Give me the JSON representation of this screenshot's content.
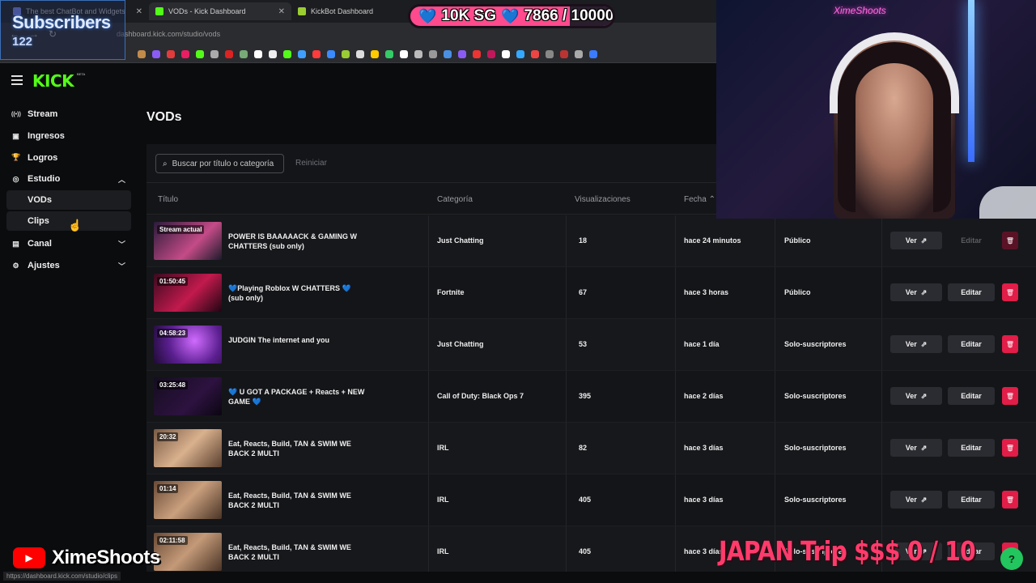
{
  "browser": {
    "tabs": [
      {
        "label": "The best ChatBot and Widgets",
        "fav_color": "#7c8cff",
        "active": false
      },
      {
        "label": "VODs - Kick Dashboard",
        "fav_color": "#53fc18",
        "active": true
      },
      {
        "label": "KickBot Dashboard",
        "fav_color": "#9acd32",
        "active": false
      }
    ],
    "url": "dashboard.kick.com/studio/vods",
    "status_url": "https://dashboard.kick.com/studio/clips"
  },
  "overlays": {
    "subs_title": "Subscribers",
    "subs_count": "122",
    "goal_text": "10K SG",
    "goal_count": "7866 / 10000",
    "goal_progress": 0.7866,
    "youtube_handle": "XimeShoots",
    "japan_goal": "JAPAN Trip $$$ 0 / 10",
    "cam_sign": "XimeShoots"
  },
  "app": {
    "logo": "KICK",
    "beta": "BETA",
    "page_title": "VODs",
    "search_placeholder": "Buscar por título o categoría",
    "reset_label": "Reiniciar"
  },
  "sidebar": {
    "items": [
      {
        "label": "Stream",
        "icon": "broadcast-icon"
      },
      {
        "label": "Ingresos",
        "icon": "money-icon"
      },
      {
        "label": "Logros",
        "icon": "trophy-icon"
      },
      {
        "label": "Estudio",
        "icon": "studio-icon",
        "expanded": true
      }
    ],
    "sub_items": [
      "VODs",
      "Clips"
    ],
    "items_after": [
      {
        "label": "Canal",
        "icon": "channel-icon"
      },
      {
        "label": "Ajustes",
        "icon": "gear-icon"
      }
    ]
  },
  "table": {
    "headers": {
      "title": "Título",
      "category": "Categoría",
      "views": "Visualizaciones",
      "date": "Fecha"
    },
    "view_label": "Ver",
    "edit_label": "Editar",
    "rows": [
      {
        "badge": "Stream actual",
        "title": "POWER IS BAAAAACK & GAMING W CHATTERS (sub only)",
        "category": "Just Chatting",
        "views": "18",
        "date": "hace 24 minutos",
        "visibility": "Público",
        "edit_disabled": true,
        "thumb": "linear-gradient(135deg,#2a1b3a,#c44b87 60%,#1b1b2b)"
      },
      {
        "badge": "01:50:45",
        "title": "💙Playing Roblox W CHATTERS 💙 (sub only)",
        "category": "Fortnite",
        "views": "67",
        "date": "hace 3 horas",
        "visibility": "Público",
        "edit_disabled": false,
        "thumb": "linear-gradient(135deg,#3a0a1f,#c21a4d 55%,#200512)"
      },
      {
        "badge": "04:58:23",
        "title": "JUDGIN The internet and you",
        "category": "Just Chatting",
        "views": "53",
        "date": "hace 1 día",
        "visibility": "Solo-suscriptores",
        "edit_disabled": false,
        "thumb": "radial-gradient(circle at 60% 40%,#d06bff,#5a1f8f 55%,#1d0b33)"
      },
      {
        "badge": "03:25:48",
        "title": "💙 U GOT A PACKAGE + Reacts + NEW GAME 💙",
        "category": "Call of Duty: Black Ops 7",
        "views": "395",
        "date": "hace 2 días",
        "visibility": "Solo-suscriptores",
        "edit_disabled": false,
        "thumb": "linear-gradient(135deg,#150d1f,#2d1240 60%,#0a0610)"
      },
      {
        "badge": "20:32",
        "title": "Eat, Reacts, Build, TAN & SWIM WE BACK 2 MULTI",
        "category": "IRL",
        "views": "82",
        "date": "hace 3 días",
        "visibility": "Solo-suscriptores",
        "edit_disabled": false,
        "thumb": "linear-gradient(135deg,#7a5a44,#d9b18e 50%,#5a3f2e)"
      },
      {
        "badge": "01:14",
        "title": "Eat, Reacts, Build, TAN & SWIM WE BACK 2 MULTI",
        "category": "IRL",
        "views": "405",
        "date": "hace 3 días",
        "visibility": "Solo-suscriptores",
        "edit_disabled": false,
        "thumb": "linear-gradient(135deg,#6a4a36,#caa07e 50%,#4a3426)"
      },
      {
        "badge": "02:11:58",
        "title": "Eat, Reacts, Build, TAN & SWIM WE BACK 2 MULTI",
        "category": "IRL",
        "views": "405",
        "date": "hace 3 días",
        "visibility": "Solo-suscriptores",
        "edit_disabled": false,
        "thumb": "linear-gradient(135deg,#6a4a36,#c49a78 50%,#4a3426)"
      }
    ]
  },
  "colors": {
    "accent": "#53fc18",
    "danger": "#e11d48",
    "goal": "#ff4a8d"
  }
}
